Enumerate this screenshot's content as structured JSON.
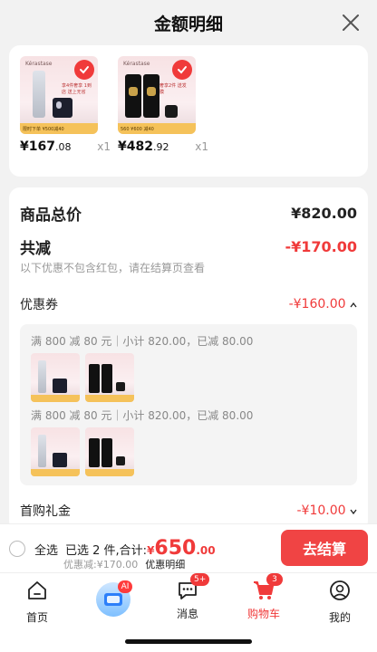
{
  "title": "金额明细",
  "products": [
    {
      "brand": "Kérastase",
      "promo": "享4件奢享 1到店 送上无省",
      "footer": "限时下单 ¥500减40",
      "price_int": "¥167",
      "price_dec": ".08",
      "qty": "x1",
      "selected": true
    },
    {
      "brand": "Kérastase",
      "promo": "奢享2件 送发膜",
      "footer": "560 ¥600 减40",
      "price_int": "¥482",
      "price_dec": ".92",
      "qty": "x1",
      "selected": true
    }
  ],
  "summary": {
    "total_label": "商品总价",
    "total_value": "¥820.00",
    "reduce_label": "共减",
    "reduce_value": "-¥170.00",
    "note": "以下优惠不包含红包，请在结算页查看",
    "coupon_label": "优惠券",
    "coupon_value": "-¥160.00",
    "coupon_lines": [
      "满 800 减 80 元｜小计 820.00，已减 80.00",
      "满 800 减 80 元｜小计 820.00，已减 80.00"
    ],
    "first_label": "首购礼金",
    "first_value": "-¥10.00"
  },
  "checkout": {
    "select_all": "全选",
    "selected_text": "已选 2 件,合计:",
    "amount_symbol": "¥",
    "amount_int": "650",
    "amount_dec": ".00",
    "discount_text": "优惠减:¥170.00",
    "detail_link": "优惠明细",
    "pay_label": "去结算"
  },
  "tabs": [
    {
      "label": "首页",
      "badge": ""
    },
    {
      "label": "",
      "badge": "AI"
    },
    {
      "label": "消息",
      "badge": "5+"
    },
    {
      "label": "购物车",
      "badge": "3"
    },
    {
      "label": "我的",
      "badge": ""
    }
  ],
  "colors": {
    "accent": "#f03a3a",
    "pay_button": "#f04444"
  }
}
